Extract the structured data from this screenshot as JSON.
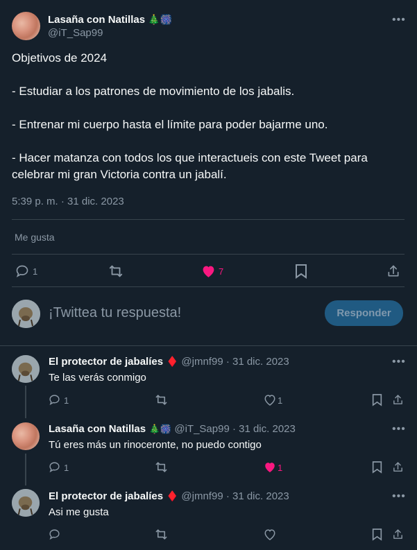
{
  "tweet": {
    "author_name": "Lasaña con Natillas",
    "author_emojis": "🎄🎆",
    "handle": "@iT_Sap99",
    "text_line1": "Objetivos de 2024",
    "text_line2": "- Estudiar a los patrones de movimiento de los jabalis.",
    "text_line3": "- Entrenar mi cuerpo hasta el límite para poder bajarme uno.",
    "text_line4a": "- Hacer matanza con todos los que interactueis con este Tweet para",
    "text_line4b": "celebrar mi gran Victoria contra un jabalí.",
    "timestamp": "5:39 p. m. · 31 dic. 2023",
    "likes_label": "Me gusta",
    "reply_count": "1",
    "like_count": "7"
  },
  "composer": {
    "placeholder": "¡Twittea tu respuesta!",
    "button_label": "Responder"
  },
  "replies": [
    {
      "name": "El protector de jabalíes",
      "emoji": "♦️",
      "handle_date": "@jmnf99 · 31 dic. 2023",
      "text": "Te las verás conmigo",
      "reply_count": "1",
      "like_count": "1"
    },
    {
      "name": "Lasaña con Natillas",
      "emoji": "🎄🎆",
      "handle_date": "@iT_Sap99 · 31 dic. 2023",
      "text": "Tú eres más un rinoceronte, no puedo contigo",
      "reply_count": "1",
      "like_count": "1"
    },
    {
      "name": "El protector de jabalíes",
      "emoji": "♦️",
      "handle_date": "@jmnf99 · 31 dic. 2023",
      "text": "Asi me gusta",
      "reply_count": "",
      "like_count": ""
    }
  ],
  "colors": {
    "background": "#15202b",
    "text": "#f7f9f9",
    "secondary": "#8b98a5",
    "like_pink": "#f91880",
    "button": "#205a82"
  },
  "icons": [
    "more-icon",
    "reply-icon",
    "retweet-icon",
    "heart-icon",
    "bookmark-icon",
    "share-icon"
  ]
}
